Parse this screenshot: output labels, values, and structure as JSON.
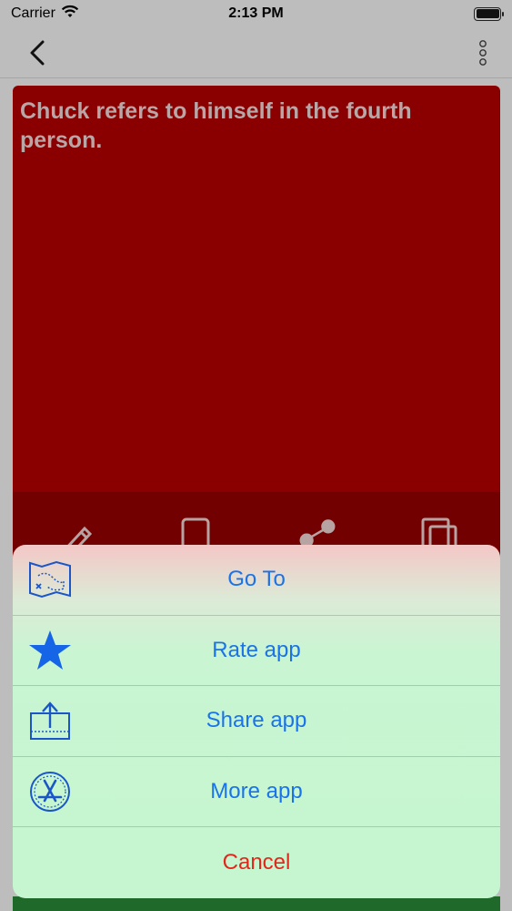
{
  "status_bar": {
    "carrier": "Carrier",
    "time": "2:13 PM"
  },
  "nav_bar": {
    "back_icon": "chevron-left-icon",
    "more_icon": "vertical-ellipsis-icon"
  },
  "content": {
    "fact_text": "Chuck refers to himself in the fourth person.",
    "card_color": "#8a0000",
    "text_color": "#b9a6a6"
  },
  "toolbar": {
    "icons": [
      "pencil-icon",
      "phone-icon",
      "share-nodes-icon",
      "copy-icon"
    ]
  },
  "action_sheet": {
    "accent_color": "#1a73e8",
    "cancel_color": "#e2261b",
    "items": [
      {
        "label": "Go To",
        "icon": "treasure-map-icon"
      },
      {
        "label": "Rate app",
        "icon": "star-icon"
      },
      {
        "label": "Share app",
        "icon": "share-box-icon"
      },
      {
        "label": "More app",
        "icon": "app-store-icon"
      }
    ],
    "cancel_label": "Cancel"
  }
}
